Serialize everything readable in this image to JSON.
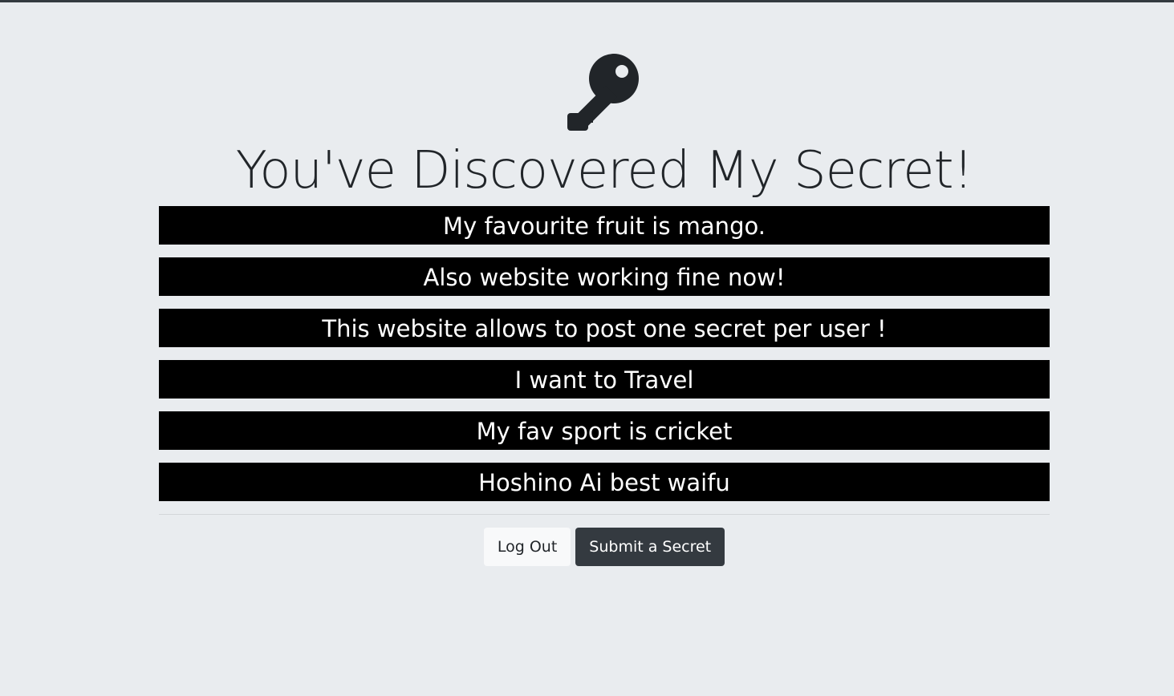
{
  "page": {
    "title": "You've Discovered My Secret!",
    "icon": "key-icon"
  },
  "secrets": [
    "My favourite fruit is mango.",
    "Also website working fine now!",
    "This website allows to post one secret per user !",
    "I want to Travel",
    "My fav sport is cricket",
    "Hoshino Ai best waifu"
  ],
  "buttons": {
    "logout_label": "Log Out",
    "submit_label": "Submit a Secret"
  },
  "colors": {
    "background": "#e9ecef",
    "secret_bg": "#000000",
    "secret_text": "#ffffff",
    "dark_button": "#343a40",
    "light_button": "#f8f9fa"
  }
}
